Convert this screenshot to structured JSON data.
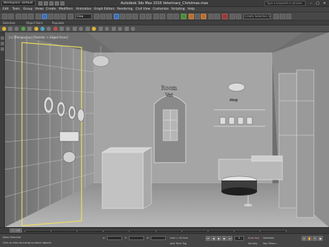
{
  "window": {
    "title": "Autodesk 3ds Max 2016    Veterinary_Christmas.max",
    "workspace": "Workspace: Default",
    "search_placeholder": "Type a keyword or phrase"
  },
  "menu": {
    "items": [
      "Edit",
      "Tools",
      "Group",
      "Views",
      "Create",
      "Modifiers",
      "Animation",
      "Graph Editors",
      "Rendering",
      "Civil View",
      "Customize",
      "Scripting",
      "Help"
    ]
  },
  "toolbar": {
    "view_select": "View",
    "selection_set": "Create Selection Se"
  },
  "ribbon": {
    "tabs": [
      "Selection",
      "Object Paint",
      "Populate"
    ]
  },
  "viewport": {
    "label": "[+] [Perspective] [Realistic + Edged Faces]",
    "scene_signs": {
      "room_sign_line1": "Room",
      "room_sign_line2": "Vet",
      "shop_sign": "shop"
    }
  },
  "timeline": {
    "slider_label": "0 / 100",
    "ticks": [
      0,
      10,
      20,
      30,
      40,
      50,
      60,
      70,
      80,
      90,
      100
    ]
  },
  "statusbar": {
    "selection_info": "None Selected",
    "prompt": "Click or click-and-drag to select objects",
    "x_label": "X:",
    "y_label": "Y:",
    "z_label": "Z:",
    "grid": "Grid = 10.0cm",
    "auto_key": "Auto Key",
    "set_key": "Set Key",
    "selected": "Selected",
    "key_filters": "Key Filters...",
    "frame": "0",
    "add_time_tag": "Add Time Tag"
  }
}
